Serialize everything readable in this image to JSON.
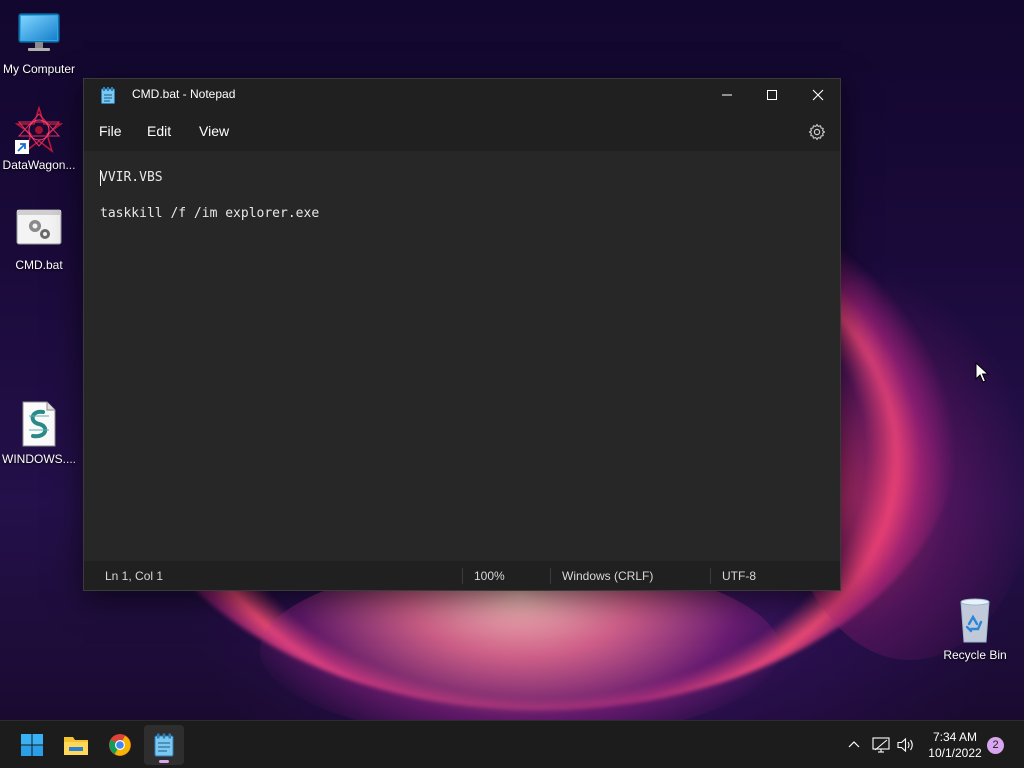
{
  "desktop": {
    "icons": [
      {
        "label": "My Computer"
      },
      {
        "label": "DataWagon..."
      },
      {
        "label": "CMD.bat"
      },
      {
        "label": "WINDOWS...."
      },
      {
        "label": "Recycle Bin"
      }
    ]
  },
  "notepad": {
    "title": "CMD.bat - Notepad",
    "menu": [
      "File",
      "Edit",
      "View"
    ],
    "content_lines": [
      "VVIR.VBS",
      "taskkill /f /im explorer.exe"
    ],
    "status": {
      "position": "Ln 1, Col 1",
      "zoom": "100%",
      "line_ending": "Windows (CRLF)",
      "encoding": "UTF-8"
    }
  },
  "taskbar": {
    "time": "7:34 AM",
    "date": "10/1/2022",
    "notification_count": "2"
  },
  "colors": {
    "window_bg": "#202020",
    "editor_bg": "#272727",
    "taskbar_bg": "#1c1c1c",
    "badge": "#d8a6ee"
  }
}
